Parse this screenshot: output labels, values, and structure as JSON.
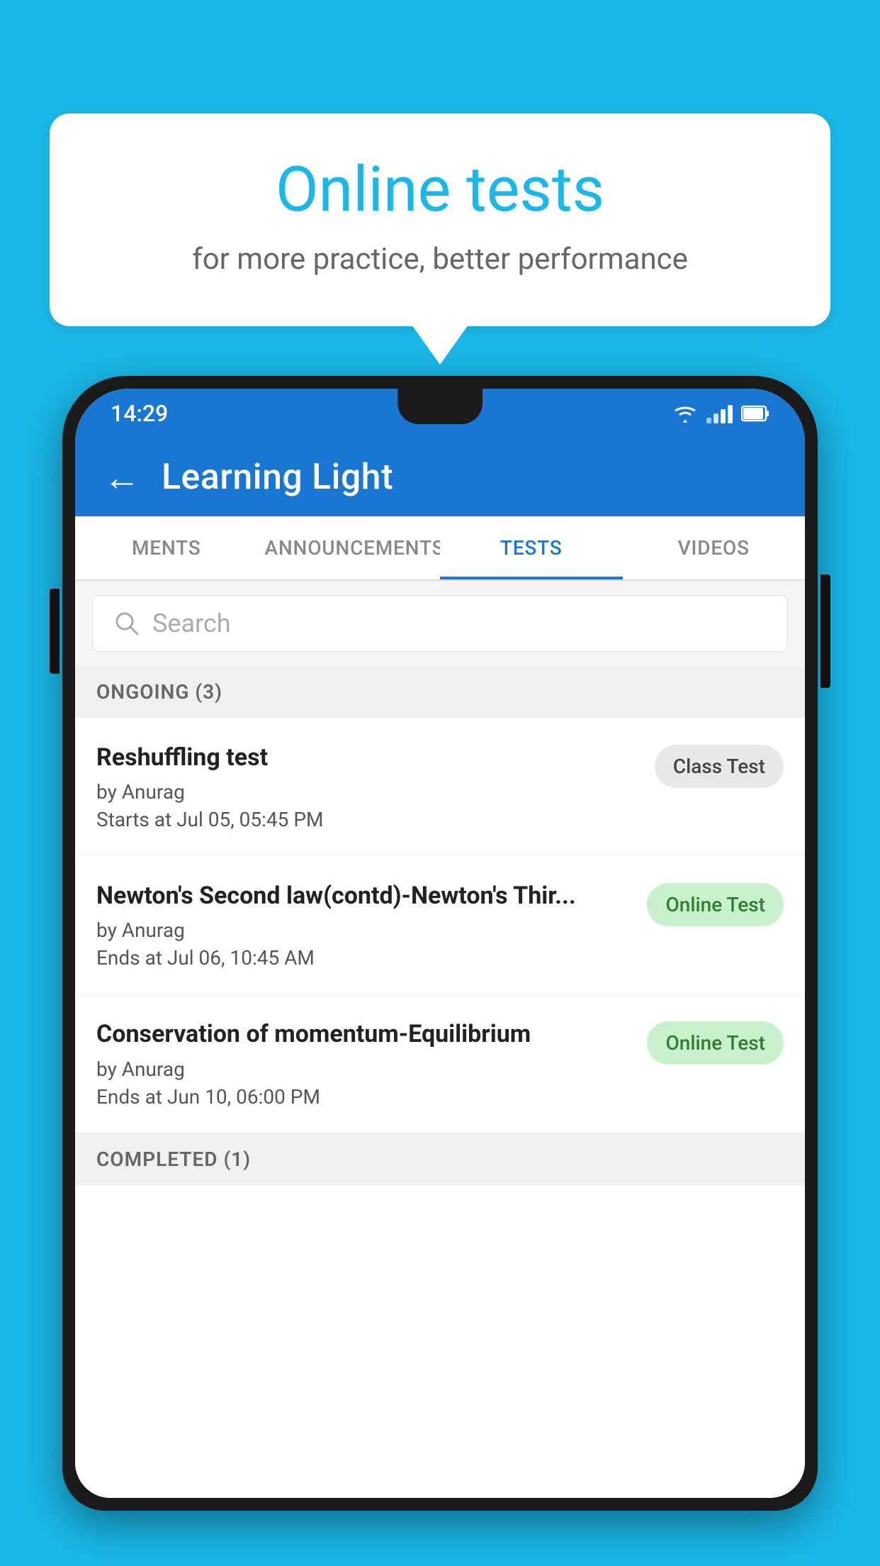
{
  "background_color": "#1ab8e8",
  "speech_bubble": {
    "title": "Online tests",
    "subtitle": "for more practice, better performance"
  },
  "phone": {
    "status_bar": {
      "time": "14:29",
      "wifi": "▾",
      "battery": "▮"
    },
    "app_bar": {
      "title": "Learning Light",
      "back_label": "←"
    },
    "tabs": [
      {
        "label": "MENTS",
        "active": false
      },
      {
        "label": "ANNOUNCEMENTS",
        "active": false
      },
      {
        "label": "TESTS",
        "active": true
      },
      {
        "label": "VIDEOS",
        "active": false
      }
    ],
    "search": {
      "placeholder": "Search"
    },
    "sections": [
      {
        "header": "ONGOING (3)",
        "items": [
          {
            "title": "Reshuffling test",
            "author": "by Anurag",
            "date": "Starts at  Jul 05, 05:45 PM",
            "badge": "Class Test",
            "badge_type": "class"
          },
          {
            "title": "Newton's Second law(contd)-Newton's Thir...",
            "author": "by Anurag",
            "date": "Ends at  Jul 06, 10:45 AM",
            "badge": "Online Test",
            "badge_type": "online"
          },
          {
            "title": "Conservation of momentum-Equilibrium",
            "author": "by Anurag",
            "date": "Ends at  Jun 10, 06:00 PM",
            "badge": "Online Test",
            "badge_type": "online"
          }
        ]
      },
      {
        "header": "COMPLETED (1)",
        "items": []
      }
    ]
  }
}
